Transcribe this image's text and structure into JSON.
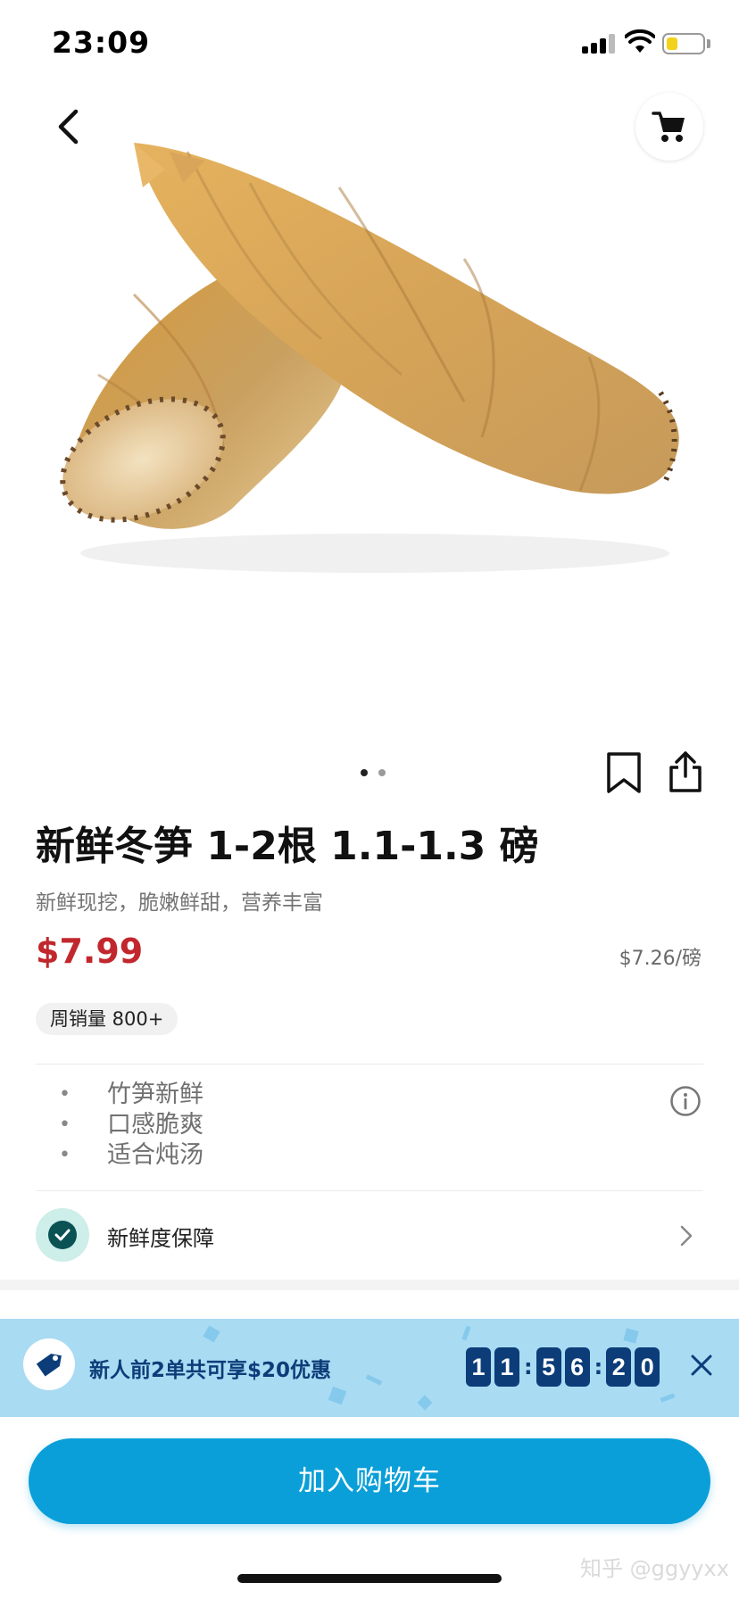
{
  "status_bar": {
    "time": "23:09"
  },
  "product": {
    "title": "新鲜冬笋 1-2根 1.1-1.3 磅",
    "subtitle": "新鲜现挖，脆嫩鲜甜，营养丰富",
    "price": "$7.99",
    "unit_price": "$7.26/磅",
    "sales_badge": "周销量 800+",
    "image_count": 2,
    "active_image_index": 0,
    "features": [
      "竹笋新鲜",
      "口感脆爽",
      "适合炖汤"
    ],
    "guarantee_label": "新鲜度保障"
  },
  "promo": {
    "text": "新人前2单共可享$20优惠",
    "countdown": {
      "hours": [
        "1",
        "1"
      ],
      "minutes": [
        "5",
        "6"
      ],
      "seconds": [
        "2",
        "0"
      ]
    }
  },
  "cta": {
    "add_to_cart_label": "加入购物车"
  },
  "watermark": "知乎 @ggyyxx",
  "colors": {
    "price": "#c1272d",
    "accent": "#0a9fd8",
    "promo_bg": "#a9dbf3",
    "promo_text": "#0c3d79",
    "guarantee": "#0a5254"
  },
  "icons": [
    "back-chevron-icon",
    "cart-icon",
    "bookmark-icon",
    "share-icon",
    "info-icon",
    "check-icon",
    "chevron-right-icon",
    "price-tag-icon",
    "close-icon"
  ]
}
